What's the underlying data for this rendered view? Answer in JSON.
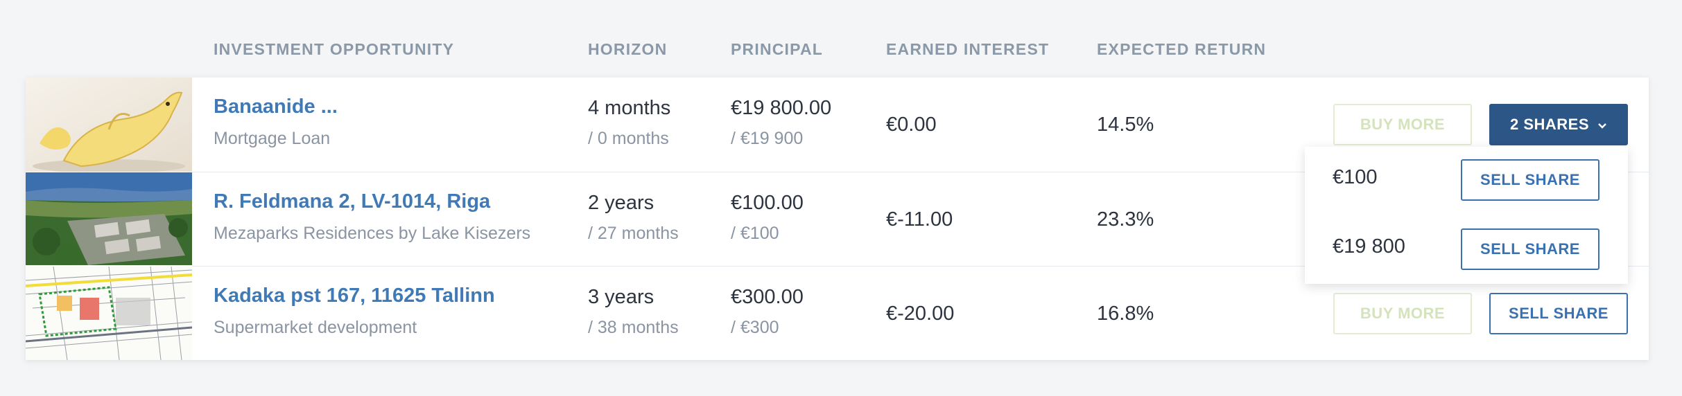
{
  "columns": {
    "opportunity": "INVESTMENT OPPORTUNITY",
    "horizon": "HORIZON",
    "principal": "PRINCIPAL",
    "earned": "EARNED INTEREST",
    "expected": "EXPECTED RETURN"
  },
  "rows": [
    {
      "name": "Banaanide ...",
      "subtitle": "Mortgage Loan",
      "horizon": "4 months",
      "horizon_sub": "/ 0 months",
      "principal": "€19 800.00",
      "principal_sub": "/ €19 900",
      "earned": "€0.00",
      "expected": "14.5%",
      "buy_label": "BUY MORE",
      "action_label": "2 SHARES",
      "thumbnail": "banana-dolphin-image"
    },
    {
      "name": "R. Feldmana 2, LV-1014, Riga",
      "subtitle": "Mezaparks Residences by Lake Kisezers",
      "horizon": "2 years",
      "horizon_sub": "/ 27 months",
      "principal": "€100.00",
      "principal_sub": "/ €100",
      "earned": "€-11.00",
      "expected": "23.3%",
      "thumbnail": "aerial-residences-image"
    },
    {
      "name": "Kadaka pst 167, 11625 Tallinn",
      "subtitle": "Supermarket development",
      "horizon": "3 years",
      "horizon_sub": "/ 38 months",
      "principal": "€300.00",
      "principal_sub": "/ €300",
      "earned": "€-20.00",
      "expected": "16.8%",
      "buy_label": "BUY MORE",
      "action_label": "SELL SHARE",
      "thumbnail": "site-plan-image"
    }
  ],
  "dropdown": {
    "items": [
      {
        "amount": "€100",
        "action": "SELL SHARE"
      },
      {
        "amount": "€19 800",
        "action": "SELL SHARE"
      }
    ]
  },
  "colors": {
    "link": "#3f7ab6",
    "primary_button": "#2c5686",
    "disabled_buy": "#d5e3bd",
    "header_text": "#8b98a8"
  }
}
